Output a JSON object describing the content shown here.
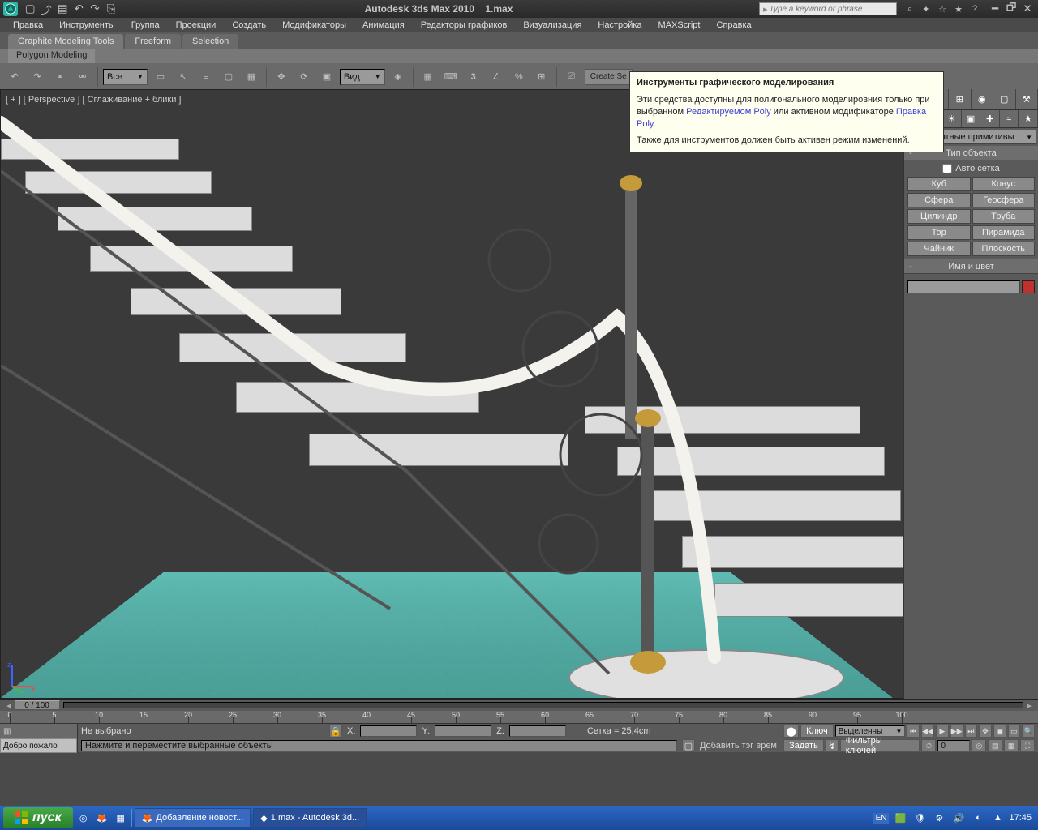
{
  "title": {
    "app": "Autodesk 3ds Max  2010",
    "file": "1.max"
  },
  "search_placeholder": "Type a keyword or phrase",
  "menu": [
    "Правка",
    "Инструменты",
    "Группа",
    "Проекции",
    "Создать",
    "Модификаторы",
    "Анимация",
    "Редакторы графиков",
    "Визуализация",
    "Настройка",
    "MAXScript",
    "Справка"
  ],
  "ribbon": {
    "tabs": [
      "Graphite Modeling Tools",
      "Freeform",
      "Selection"
    ],
    "subtab": "Polygon Modeling",
    "combo_all": "Все",
    "combo_view": "Вид",
    "create_sel": "Create Se"
  },
  "tooltip": {
    "title": "Инструменты графического моделирования",
    "body1": "Эти средства доступны для полигонального моделировния только при выбранном ",
    "link1": "Редактируемом Poly",
    "body2": " или активном модификаторе ",
    "link2": "Правка Poly",
    "body3": ".",
    "body4": "Также для инструментов должен быть активен режим изменений."
  },
  "viewport_label": "[ + ] [ Perspective ] [ Сглаживание + блики ]",
  "cmd": {
    "primitives_label": "Стандартные примитивы",
    "obj_type": "Тип объекта",
    "autogrid": "Авто сетка",
    "buttons": [
      [
        "Куб",
        "Конус"
      ],
      [
        "Сфера",
        "Геосфера"
      ],
      [
        "Цилиндр",
        "Труба"
      ],
      [
        "Тор",
        "Пирамида"
      ],
      [
        "Чайник",
        "Плоскость"
      ]
    ],
    "name_color": "Имя и цвет"
  },
  "timeline": {
    "scrub": "0 / 100",
    "ticks": [
      0,
      5,
      10,
      15,
      20,
      25,
      30,
      35,
      40,
      45,
      50,
      55,
      60,
      65,
      70,
      75,
      80,
      85,
      90,
      95,
      100
    ]
  },
  "status": {
    "welcome": "Добро пожало",
    "none_selected": "Не выбрано",
    "hint": "Нажмите и переместите выбранные объекты",
    "x": "X:",
    "y": "Y:",
    "z": "Z:",
    "grid": "Сетка = 25,4cm",
    "add_tag": "Добавить тэг врем",
    "key": "Ключ",
    "selected": "Выделенны",
    "set": "Задать",
    "filters": "Фильтры ключей"
  },
  "taskbar": {
    "start": "пуск",
    "items": [
      "Добавление новост...",
      "1.max - Autodesk 3d..."
    ],
    "lang": "EN",
    "clock": "17:45"
  }
}
